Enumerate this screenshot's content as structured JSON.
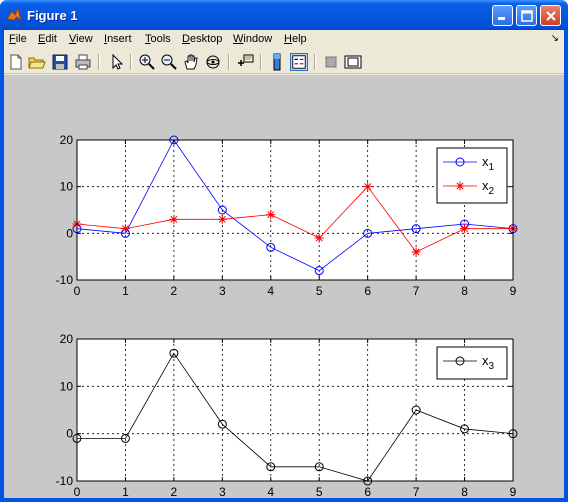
{
  "window": {
    "title": "Figure 1"
  },
  "menu": [
    {
      "u": "F",
      "rest": "ile"
    },
    {
      "u": "E",
      "rest": "dit"
    },
    {
      "u": "V",
      "rest": "iew"
    },
    {
      "u": "I",
      "rest": "nsert"
    },
    {
      "u": "T",
      "rest": "ools"
    },
    {
      "u": "D",
      "rest": "esktop"
    },
    {
      "u": "W",
      "rest": "indow"
    },
    {
      "u": "H",
      "rest": "elp"
    }
  ],
  "colors": {
    "x1": "#0000ff",
    "x2": "#ff0000",
    "x3": "#000000",
    "figure_bg": "#c8c8c8"
  },
  "chart_data": [
    {
      "type": "line",
      "x": [
        0,
        1,
        2,
        3,
        4,
        5,
        6,
        7,
        8,
        9
      ],
      "xticks": [
        "0",
        "1",
        "2",
        "3",
        "4",
        "5",
        "6",
        "7",
        "8",
        "9"
      ],
      "yticks": [
        "-10",
        "0",
        "10",
        "20"
      ],
      "xlim": [
        0,
        9
      ],
      "ylim": [
        -10,
        20
      ],
      "grid": true,
      "legend": "top-right",
      "series": [
        {
          "name": "x1",
          "legend_base": "x",
          "legend_sub": "1",
          "marker": "circle",
          "values": [
            1,
            0,
            20,
            5,
            -3,
            -8,
            0,
            1,
            2,
            1
          ]
        },
        {
          "name": "x2",
          "legend_base": "x",
          "legend_sub": "2",
          "marker": "star",
          "values": [
            2,
            1,
            3,
            3,
            4,
            -1,
            10,
            -4,
            1,
            1
          ]
        }
      ]
    },
    {
      "type": "line",
      "x": [
        0,
        1,
        2,
        3,
        4,
        5,
        6,
        7,
        8,
        9
      ],
      "xticks": [
        "0",
        "1",
        "2",
        "3",
        "4",
        "5",
        "6",
        "7",
        "8",
        "9"
      ],
      "yticks": [
        "-10",
        "0",
        "10",
        "20"
      ],
      "xlim": [
        0,
        9
      ],
      "ylim": [
        -10,
        20
      ],
      "grid": true,
      "legend": "top-right",
      "series": [
        {
          "name": "x3",
          "legend_base": "x",
          "legend_sub": "3",
          "marker": "circle",
          "values": [
            -1,
            -1,
            17,
            2,
            -7,
            -7,
            -10,
            5,
            1,
            0
          ]
        }
      ]
    }
  ]
}
